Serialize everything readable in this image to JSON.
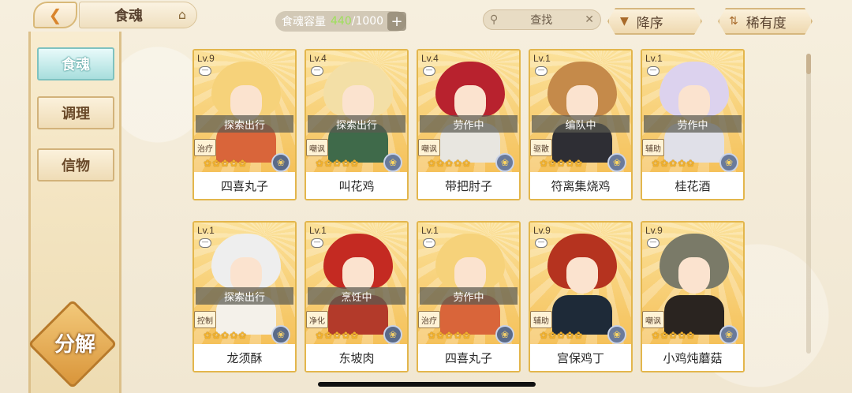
{
  "header": {
    "title": "食魂",
    "capacity_label": "食魂容量",
    "capacity_current": "440",
    "capacity_max": "/1000",
    "search_label": "查找",
    "sort_order": "降序",
    "sort_key": "稀有度"
  },
  "sidebar": {
    "tabs": [
      {
        "label": "食魂"
      },
      {
        "label": "调理"
      },
      {
        "label": "信物"
      }
    ],
    "decompose_label": "分解"
  },
  "cards": [
    {
      "level": "Lv.9",
      "status": "探索出行",
      "role": "治疗",
      "name": "四喜丸子",
      "hair": "#f6d27a",
      "outfit": "#d9653a",
      "elem": "dark-orb"
    },
    {
      "level": "Lv.4",
      "status": "探索出行",
      "role": "嘲讽",
      "name": "叫花鸡",
      "hair": "#f3dfa6",
      "outfit": "#3f6a4a",
      "elem": "gold-orb"
    },
    {
      "level": "Lv.4",
      "status": "劳作中",
      "role": "嘲讽",
      "name": "带把肘子",
      "hair": "#b8222e",
      "outfit": "#e8e6e0",
      "elem": "gold-orb"
    },
    {
      "level": "Lv.1",
      "status": "编队中",
      "role": "驱散",
      "name": "符离集烧鸡",
      "hair": "#c58a4a",
      "outfit": "#2e2e34",
      "elem": "gold-orb"
    },
    {
      "level": "Lv.1",
      "status": "劳作中",
      "role": "辅助",
      "name": "桂花酒",
      "hair": "#dcd2ee",
      "outfit": "#e0e0e8",
      "elem": "gold-orb"
    },
    {
      "level": "Lv.1",
      "status": "探索出行",
      "role": "控制",
      "name": "龙须酥",
      "hair": "#eeeeee",
      "outfit": "#f4f1ea",
      "elem": "dark-orb"
    },
    {
      "level": "Lv.1",
      "status": "烹饪中",
      "role": "净化",
      "name": "东坡肉",
      "hair": "#c42a22",
      "outfit": "#b33a2a",
      "elem": "dark-orb"
    },
    {
      "level": "Lv.1",
      "status": "劳作中",
      "role": "治疗",
      "name": "四喜丸子",
      "hair": "#f6d27a",
      "outfit": "#d9653a",
      "elem": "dark-orb"
    },
    {
      "level": "Lv.9",
      "status": "",
      "role": "辅助",
      "name": "宫保鸡丁",
      "hair": "#b5331f",
      "outfit": "#1e2a38",
      "elem": "gold-orb"
    },
    {
      "level": "Lv.9",
      "status": "",
      "role": "嘲讽",
      "name": "小鸡炖蘑菇",
      "hair": "#7a7a68",
      "outfit": "#2a2420",
      "elem": "gold-orb"
    }
  ]
}
